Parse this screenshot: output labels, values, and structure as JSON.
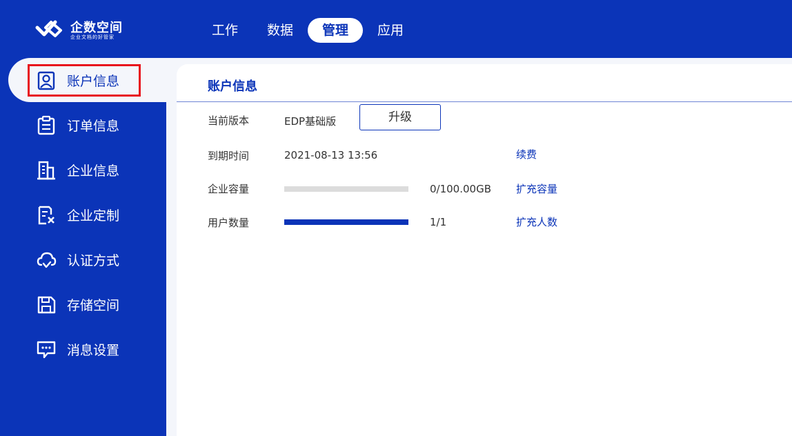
{
  "brand": {
    "title": "企数空间",
    "subtitle": "企业文档的好管家"
  },
  "topnav": {
    "tabs": [
      {
        "label": "工作",
        "active": false
      },
      {
        "label": "数据",
        "active": false
      },
      {
        "label": "管理",
        "active": true
      },
      {
        "label": "应用",
        "active": false
      }
    ]
  },
  "sidebar": {
    "items": [
      {
        "label": "账户信息",
        "icon": "user-card-icon",
        "active": true
      },
      {
        "label": "订单信息",
        "icon": "clipboard-icon",
        "active": false
      },
      {
        "label": "企业信息",
        "icon": "building-icon",
        "active": false
      },
      {
        "label": "企业定制",
        "icon": "document-custom-icon",
        "active": false
      },
      {
        "label": "认证方式",
        "icon": "cloud-check-icon",
        "active": false
      },
      {
        "label": "存储空间",
        "icon": "floppy-disk-icon",
        "active": false
      },
      {
        "label": "消息设置",
        "icon": "message-icon",
        "active": false
      }
    ]
  },
  "account": {
    "title": "账户信息",
    "version": {
      "label": "当前版本",
      "value": "EDP基础版",
      "button": "升级"
    },
    "expiry": {
      "label": "到期时间",
      "value": "2021-08-13 13:56",
      "link": "续费"
    },
    "capacity": {
      "label": "企业容量",
      "usage_text": "0/100.00GB",
      "usage_fraction": 0.0,
      "link": "扩充容量"
    },
    "users": {
      "label": "用户数量",
      "usage_text": "1/1",
      "usage_fraction": 1.0,
      "link": "扩充人数"
    }
  },
  "colors": {
    "brand_blue": "#0b34b8",
    "highlight_red": "#e8111c",
    "track_gray": "#dcdcdc"
  }
}
